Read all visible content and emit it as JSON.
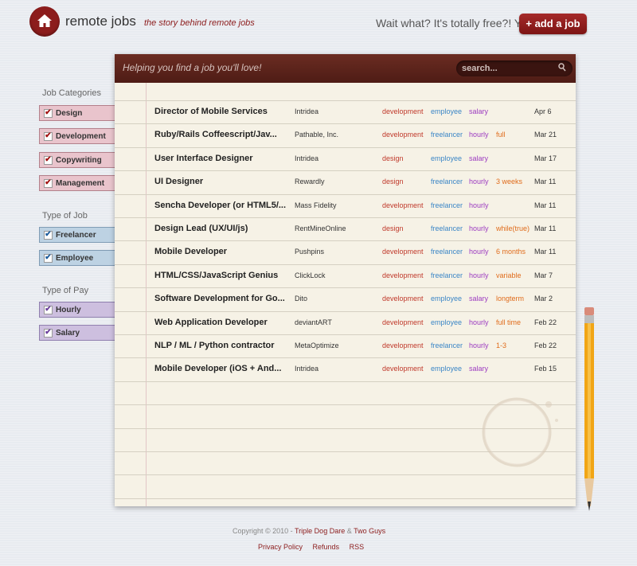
{
  "header": {
    "brand": "remote jobs",
    "tagline": "the story behind remote jobs",
    "free_text": "Wait what? It's totally free?! Yes!",
    "add_job_label": "+ add a job"
  },
  "sidebar": {
    "categories_heading": "Job Categories",
    "categories": [
      "Design",
      "Development",
      "Copywriting",
      "Management"
    ],
    "type_heading": "Type of Job",
    "types": [
      "Freelancer",
      "Employee"
    ],
    "pay_heading": "Type of Pay",
    "pays": [
      "Hourly",
      "Salary"
    ],
    "check_glyph": "✔"
  },
  "board": {
    "message": "Helping you find a job you'll love!",
    "search_placeholder": "search...",
    "jobs": [
      {
        "title": "Director of Mobile Services",
        "company": "Intridea",
        "category": "development",
        "type": "employee",
        "pay": "salary",
        "extra": "",
        "date": "Apr 6"
      },
      {
        "title": "Ruby/Rails Coffeescript/Jav...",
        "company": "Pathable, Inc.",
        "category": "development",
        "type": "freelancer",
        "pay": "hourly",
        "extra": "full",
        "date": "Mar 21"
      },
      {
        "title": "User Interface Designer",
        "company": "Intridea",
        "category": "design",
        "type": "employee",
        "pay": "salary",
        "extra": "",
        "date": "Mar 17"
      },
      {
        "title": "UI Designer",
        "company": "Rewardly",
        "category": "design",
        "type": "freelancer",
        "pay": "hourly",
        "extra": "3 weeks",
        "date": "Mar 11"
      },
      {
        "title": "Sencha Developer (or HTML5/...",
        "company": "Mass Fidelity",
        "category": "development",
        "type": "freelancer",
        "pay": "hourly",
        "extra": "",
        "date": "Mar 11"
      },
      {
        "title": "Design Lead (UX/UI/js)",
        "company": "RentMineOnline",
        "category": "design",
        "type": "freelancer",
        "pay": "hourly",
        "extra": "while(true)",
        "date": "Mar 11"
      },
      {
        "title": "Mobile Developer",
        "company": "Pushpins",
        "category": "development",
        "type": "freelancer",
        "pay": "hourly",
        "extra": "6 months",
        "date": "Mar 11"
      },
      {
        "title": "HTML/CSS/JavaScript Genius",
        "company": "ClickLock",
        "category": "development",
        "type": "freelancer",
        "pay": "hourly",
        "extra": "variable",
        "date": "Mar 7"
      },
      {
        "title": "Software Development for Go...",
        "company": "Dito",
        "category": "development",
        "type": "employee",
        "pay": "salary",
        "extra": "longterm",
        "date": "Mar 2"
      },
      {
        "title": "Web Application Developer",
        "company": "deviantART",
        "category": "development",
        "type": "employee",
        "pay": "hourly",
        "extra": "full time",
        "date": "Feb 22"
      },
      {
        "title": "NLP / ML / Python contractor",
        "company": "MetaOptimize",
        "category": "development",
        "type": "freelancer",
        "pay": "hourly",
        "extra": "1-3",
        "date": "Feb 22"
      },
      {
        "title": "Mobile Developer (iOS + And...",
        "company": "Intridea",
        "category": "development",
        "type": "employee",
        "pay": "salary",
        "extra": "",
        "date": "Feb 15"
      }
    ]
  },
  "footer": {
    "copyright": "Copyright © 2010 -",
    "link_triple": "Triple Dog Dare",
    "amp": "&",
    "link_two": "Two Guys",
    "links": [
      "Privacy Policy",
      "Refunds",
      "RSS"
    ]
  },
  "colors": {
    "brand": "#8c1c1c",
    "category": "#c0392b",
    "type": "#3b86c6",
    "pay": "#9c3bc0",
    "extra": "#e06c1c"
  }
}
